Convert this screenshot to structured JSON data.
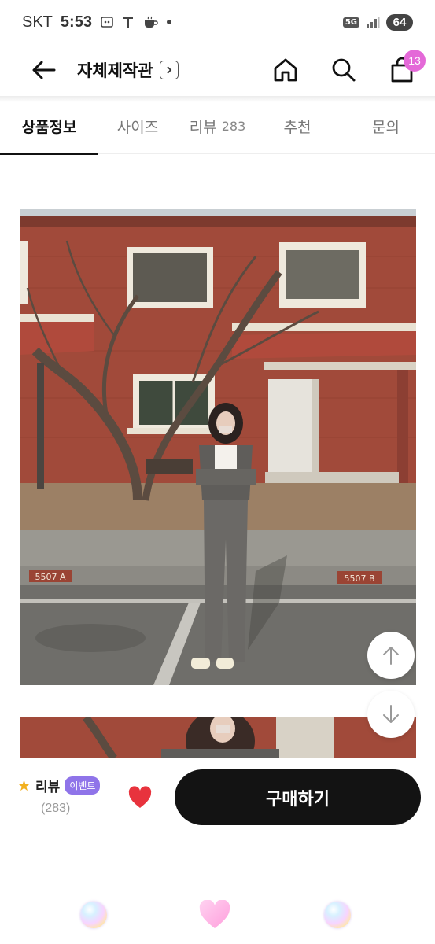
{
  "status": {
    "carrier": "SKT",
    "time": "5:53",
    "network": "5G",
    "battery": "64"
  },
  "header": {
    "title": "자체제작관",
    "cart_count": "13"
  },
  "tabs": [
    {
      "label": "상품정보",
      "active": true
    },
    {
      "label": "사이즈",
      "active": false
    },
    {
      "label": "리뷰",
      "count": "283",
      "active": false
    },
    {
      "label": "추천",
      "active": false
    },
    {
      "label": "문의",
      "active": false
    }
  ],
  "photo": {
    "sign_left": "5507 A",
    "sign_right": "5507 B"
  },
  "purchase": {
    "review_label": "리뷰",
    "event_badge": "이벤트",
    "review_count": "(283)",
    "buy_label": "구매하기"
  },
  "colors": {
    "accent_pink": "#e469d8",
    "event_purple": "#8f74e9",
    "heart_red": "#e8333d",
    "buy_button": "#131313"
  }
}
